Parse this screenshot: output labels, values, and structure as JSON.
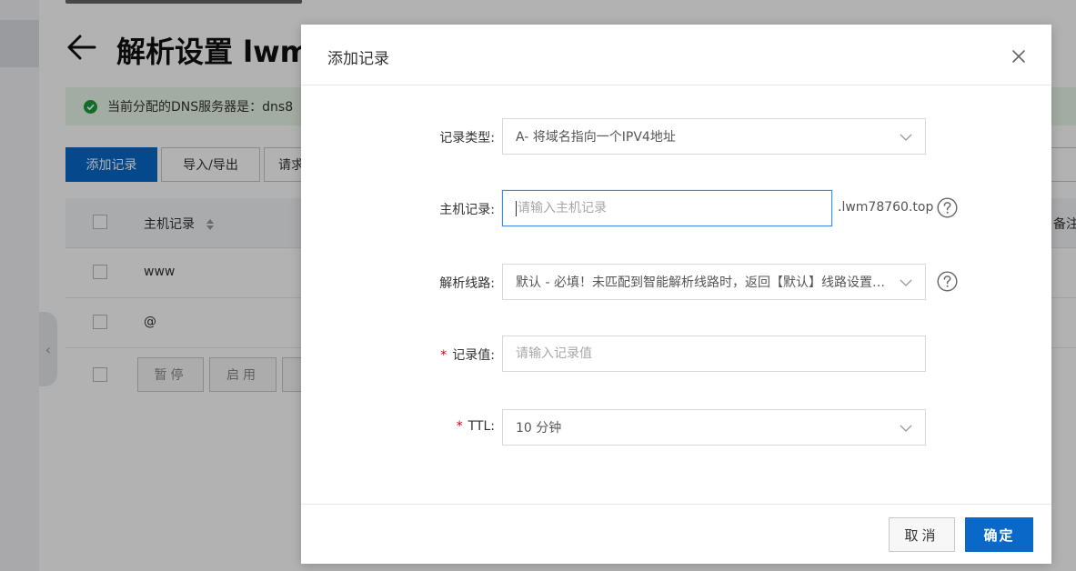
{
  "background": {
    "page_title": "解析设置 lwm",
    "dns_banner": "当前分配的DNS服务器是：dns8",
    "toolbar": {
      "add_record": "添加记录",
      "import_export": "导入/导出",
      "request": "请求"
    },
    "table": {
      "host_header": "主机记录",
      "remark_header": "备注",
      "rows": [
        "www",
        "@"
      ]
    },
    "batch": {
      "pause": "暂停",
      "enable": "启用"
    }
  },
  "modal": {
    "title": "添加记录",
    "close_icon": "close-icon",
    "fields": {
      "record_type": {
        "label": "记录类型:",
        "value": "A- 将域名指向一个IPV4地址"
      },
      "host_record": {
        "label": "主机记录:",
        "placeholder": "请输入主机记录",
        "suffix": ".lwm78760.top"
      },
      "resolve_line": {
        "label": "解析线路:",
        "value": "默认 - 必填！未匹配到智能解析线路时，返回【默认】线路设置结果"
      },
      "record_value": {
        "label": "记录值:",
        "placeholder": "请输入记录值",
        "required_mark": "*"
      },
      "ttl": {
        "label": "TTL:",
        "value": "10 分钟",
        "required_mark": "*"
      }
    },
    "footer": {
      "cancel": "取消",
      "confirm": "确定"
    }
  },
  "colors": {
    "primary": "#0a68c9",
    "focus_border": "#3a8ee6",
    "success_green": "#1a9c3e",
    "required_red": "#d0021b"
  }
}
